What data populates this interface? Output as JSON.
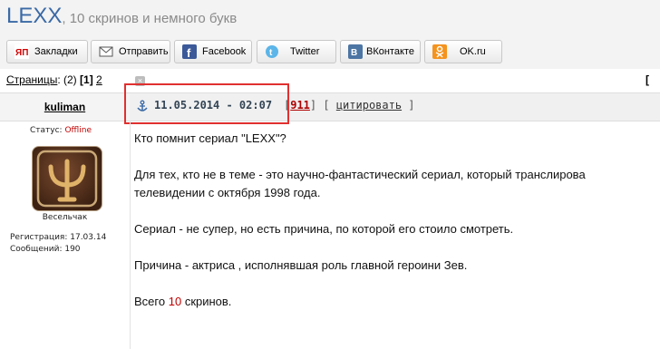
{
  "header": {
    "site_title": "LEXX",
    "site_subtitle": ", 10 скринов и немного букв"
  },
  "share_buttons": [
    {
      "label": "Закладки"
    },
    {
      "label": "Отправить"
    },
    {
      "label": "Facebook"
    },
    {
      "label": "Twitter"
    },
    {
      "label": "ВКонтакте"
    },
    {
      "label": "OK.ru"
    }
  ],
  "pagination": {
    "label": "Страницы",
    "count": "(2)",
    "current": "[1]",
    "next": "2",
    "right_bracket": "["
  },
  "post": {
    "author": "kuliman",
    "date": "11.05.2014 - 02:07",
    "number": "911",
    "quote_label": "цитировать",
    "status_label": "Статус:",
    "status_value": "Offline",
    "rank": "Весельчак",
    "registration": "Регистрация: 17.03.14",
    "messages": "Сообщений: 190",
    "paragraphs": [
      "Кто помнит сериал \"LEXX\"?",
      "Для тех, кто не в теме - это научно-фантастический сериал, который транслирова",
      "телевидении с октября 1998 года.",
      "Сериал - не супер, но есть причина, по которой его стоило смотреть.",
      "Причина - актриса , исполнявшая роль главной героини Зев."
    ],
    "last_prefix": "Всего",
    "last_count": "10",
    "last_suffix": "скринов."
  }
}
